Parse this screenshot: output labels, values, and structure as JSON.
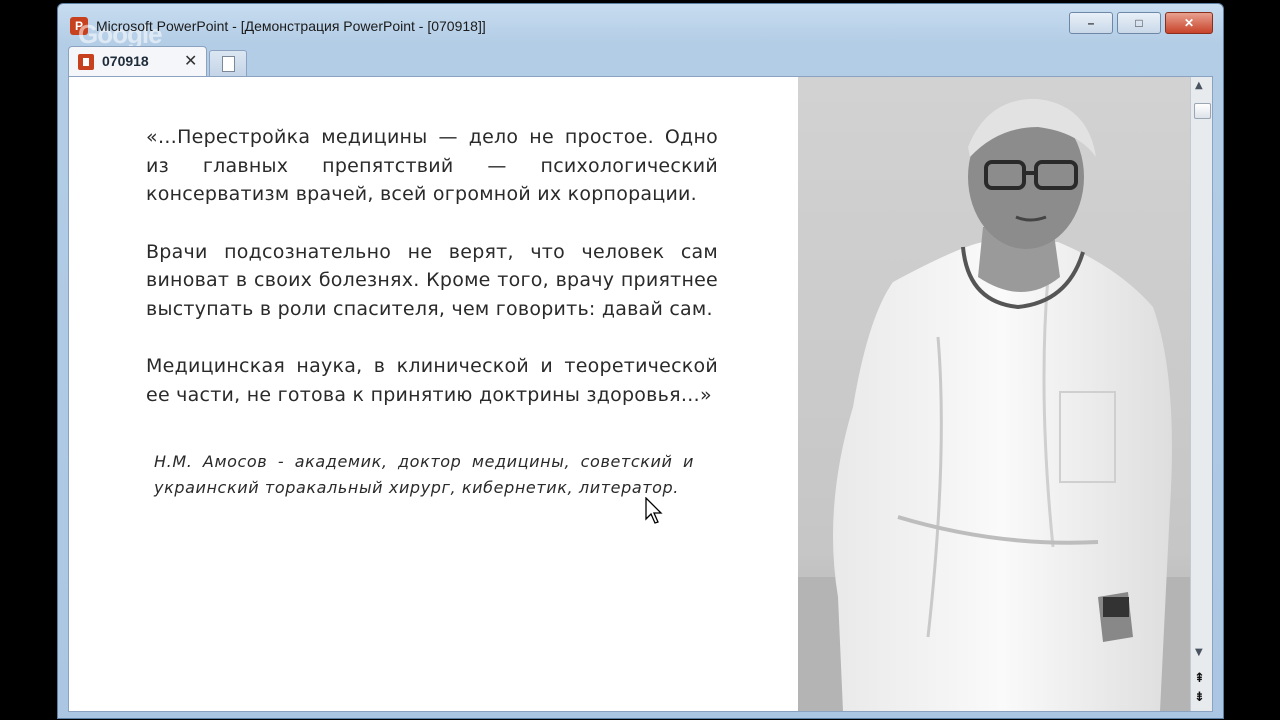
{
  "window": {
    "title": "Microsoft PowerPoint - [Демонстрация PowerPoint - [070918]]",
    "minimize_label": "–",
    "maximize_label": "□",
    "close_label": "✕",
    "watermark": "Google"
  },
  "tabs": [
    {
      "label": "070918",
      "close_label": "✕"
    }
  ],
  "slide": {
    "paragraphs": [
      "«…Перестройка медицины — дело не простое. Одно из главных препятствий — психологический консерватизм врачей, всей огромной их корпорации.",
      "Врачи подсознательно не верят, что человек сам виноват в своих болезнях. Кроме того, врачу приятнее выступать в роли спасителя, чем говорить: давай сам.",
      "Медицинская наука, в клинической и теоретической ее части, не готова к принятию доктрины здоровья…»"
    ],
    "attribution": "Н.М. Амосов - академик, доктор медицины, советский и украинский торакальный хирург, кибернетик, литератор."
  },
  "scrollbar": {
    "up_arrow": "▲",
    "down_arrow": "▼",
    "page_up": "⇞",
    "page_down": "⇟"
  },
  "colors": {
    "accent": "#c8411e",
    "window_frame": "#b3cde6"
  }
}
